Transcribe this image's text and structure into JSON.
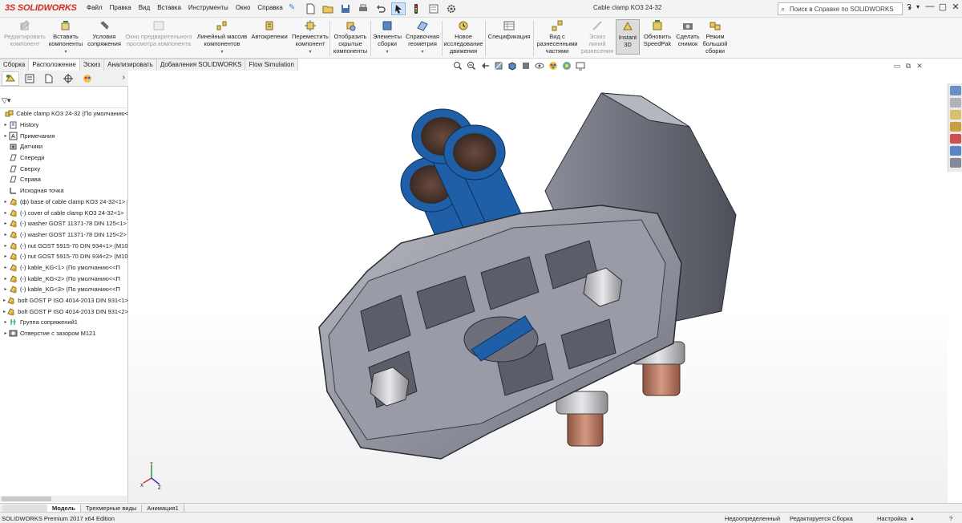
{
  "app": {
    "logo_text": "SOLIDWORKS",
    "doc_title": "Cable clamp KO3 24-32"
  },
  "menu": [
    "Файл",
    "Правка",
    "Вид",
    "Вставка",
    "Инструменты",
    "Окно",
    "Справка"
  ],
  "help_search": {
    "placeholder": "Поиск в Справке по SOLIDWORKS",
    "help_glyph": "?"
  },
  "window_controls": [
    "—",
    "▢",
    "✕"
  ],
  "ribbon": [
    {
      "label": "Редактировать компонент",
      "icon": "edit-component-icon",
      "enabled": false
    },
    {
      "label": "Вставить компоненты",
      "icon": "insert-components-icon",
      "enabled": true
    },
    {
      "label": "Условия сопряжения",
      "icon": "mate-icon",
      "enabled": true
    },
    {
      "label": "Окно предварительного просмотра компонента",
      "icon": "preview-window-icon",
      "enabled": false
    },
    {
      "label": "Линейный массив компонентов",
      "icon": "linear-pattern-icon",
      "enabled": true
    },
    {
      "label": "Автокрепежи",
      "icon": "smart-fasteners-icon",
      "enabled": true
    },
    {
      "label": "Переместить компонент",
      "icon": "move-component-icon",
      "enabled": true
    },
    {
      "label": "Отобразить скрытые компоненты",
      "icon": "show-hidden-icon",
      "enabled": true
    },
    {
      "label": "Элементы сборки",
      "icon": "assembly-features-icon",
      "enabled": true
    },
    {
      "label": "Справочная геометрия",
      "icon": "reference-geometry-icon",
      "enabled": true
    },
    {
      "label": "Новое исследование движения",
      "icon": "motion-study-icon",
      "enabled": true
    },
    {
      "label": "Спецификация",
      "icon": "bom-icon",
      "enabled": true
    },
    {
      "label": "Вид с разнесенными частями",
      "icon": "exploded-view-icon",
      "enabled": true
    },
    {
      "label": "Эскиз линий разнесения",
      "icon": "explode-line-sketch-icon",
      "enabled": false
    },
    {
      "label": "Instant 3D",
      "icon": "instant3d-icon",
      "enabled": true,
      "active": true
    },
    {
      "label": "Обновить SpeedPak",
      "icon": "speedpak-icon",
      "enabled": true
    },
    {
      "label": "Сделать снимок",
      "icon": "snapshot-icon",
      "enabled": true
    },
    {
      "label": "Режим большой сборки",
      "icon": "large-assembly-icon",
      "enabled": true
    }
  ],
  "tabs": [
    "Сборка",
    "Расположение",
    "Эскиз",
    "Анализировать",
    "Добавления SOLIDWORKS",
    "Flow Simulation"
  ],
  "active_tab": "Расположение",
  "tree": {
    "root": "Cable clamp KO3 24-32  (По умолчанию<",
    "items": [
      {
        "label": "History",
        "expandable": true,
        "icon": "history-icon"
      },
      {
        "label": "Примечания",
        "expandable": true,
        "icon": "annotations-icon"
      },
      {
        "label": "Датчики",
        "expandable": false,
        "icon": "sensors-icon"
      },
      {
        "label": "Спереди",
        "expandable": false,
        "icon": "plane-icon"
      },
      {
        "label": "Сверху",
        "expandable": false,
        "icon": "plane-icon"
      },
      {
        "label": "Справа",
        "expandable": false,
        "icon": "plane-icon"
      },
      {
        "label": "Исходная точка",
        "expandable": false,
        "icon": "origin-icon"
      },
      {
        "label": "(ф) base of cable clamp KO3 24-32<1>",
        "expandable": true,
        "icon": "part-icon"
      },
      {
        "label": "(-) cover of cable clamp KO3 24-32<1>",
        "expandable": true,
        "icon": "part-icon"
      },
      {
        "label": "(-) washer GOST 11371-78 DIN 125<1>",
        "expandable": true,
        "icon": "part-icon"
      },
      {
        "label": "(-) washer GOST 11371-78 DIN 125<2>",
        "expandable": true,
        "icon": "part-icon"
      },
      {
        "label": "(-) nut GOST 5915-70 DIN 934<1> (M10",
        "expandable": true,
        "icon": "part-icon"
      },
      {
        "label": "(-) nut GOST 5915-70 DIN 934<2> (M10",
        "expandable": true,
        "icon": "part-icon"
      },
      {
        "label": "(-) kable_KG<1> (По умолчанию<<П",
        "expandable": true,
        "icon": "part-icon"
      },
      {
        "label": "(-) kable_KG<2> (По умолчанию<<П",
        "expandable": true,
        "icon": "part-icon"
      },
      {
        "label": "(-) kable_KG<3> (По умолчанию<<П",
        "expandable": true,
        "icon": "part-icon"
      },
      {
        "label": "bolt GOST P ISO 4014-2013 DIN 931<1>",
        "expandable": true,
        "icon": "part-icon"
      },
      {
        "label": "bolt GOST P ISO 4014-2013 DIN 931<2>",
        "expandable": true,
        "icon": "part-icon"
      },
      {
        "label": "Группа сопряжений1",
        "expandable": true,
        "icon": "mates-icon"
      },
      {
        "label": "Отверстие с зазором M121",
        "expandable": true,
        "icon": "hole-icon"
      }
    ]
  },
  "bottom_tabs": [
    "Модель",
    "Трехмерные виды",
    "Анимация1"
  ],
  "active_bottom_tab": "Модель",
  "status": {
    "edition": "SOLIDWORKS Premium 2017 x64 Edition",
    "definition": "Недоопределенный",
    "editing": "Редактируется Сборка",
    "settings": "Настройка"
  },
  "colors": {
    "accent": "#d52b1e",
    "cable_blue": "#1f5fa8",
    "copper": "#b87560",
    "housing": "#8e919c"
  }
}
